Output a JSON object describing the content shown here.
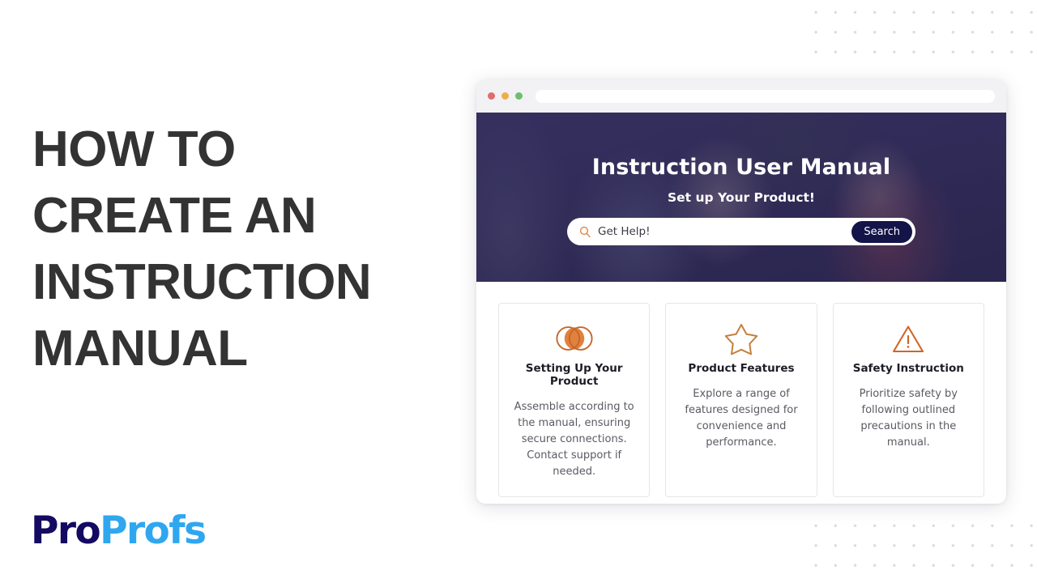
{
  "headline": "How to\ncreate an\ninstruction\nmanual",
  "logo": {
    "part_dark": "Pro",
    "part_light": "Profs",
    "color_dark": "#140a61",
    "color_light": "#2fa7f0"
  },
  "browser": {
    "traffic_lights": [
      "red",
      "yellow",
      "green"
    ],
    "address_bar_value": ""
  },
  "hero": {
    "title": "Instruction User Manual",
    "subtitle": "Set up Your Product!",
    "overlay_color": "#2d2856",
    "search": {
      "icon": "search-icon",
      "icon_color": "#e2813c",
      "placeholder": "Get Help!",
      "value": "",
      "button_label": "Search",
      "button_color": "#141449"
    }
  },
  "cards": [
    {
      "icon": "venn-circles-icon",
      "icon_color": "#c4682e",
      "title": "Setting Up Your Product",
      "text": "Assemble according to the manual, ensuring secure connections. Contact support if needed."
    },
    {
      "icon": "star-outline-icon",
      "icon_color": "#c4803e",
      "title": "Product Features",
      "text": "Explore a range of features designed for convenience and performance."
    },
    {
      "icon": "warning-triangle-icon",
      "icon_color": "#d2652a",
      "title": "Safety Instruction",
      "text": "Prioritize safety by following outlined precautions in the manual."
    }
  ],
  "decor": {
    "dot_color": "#dcdcdc"
  }
}
